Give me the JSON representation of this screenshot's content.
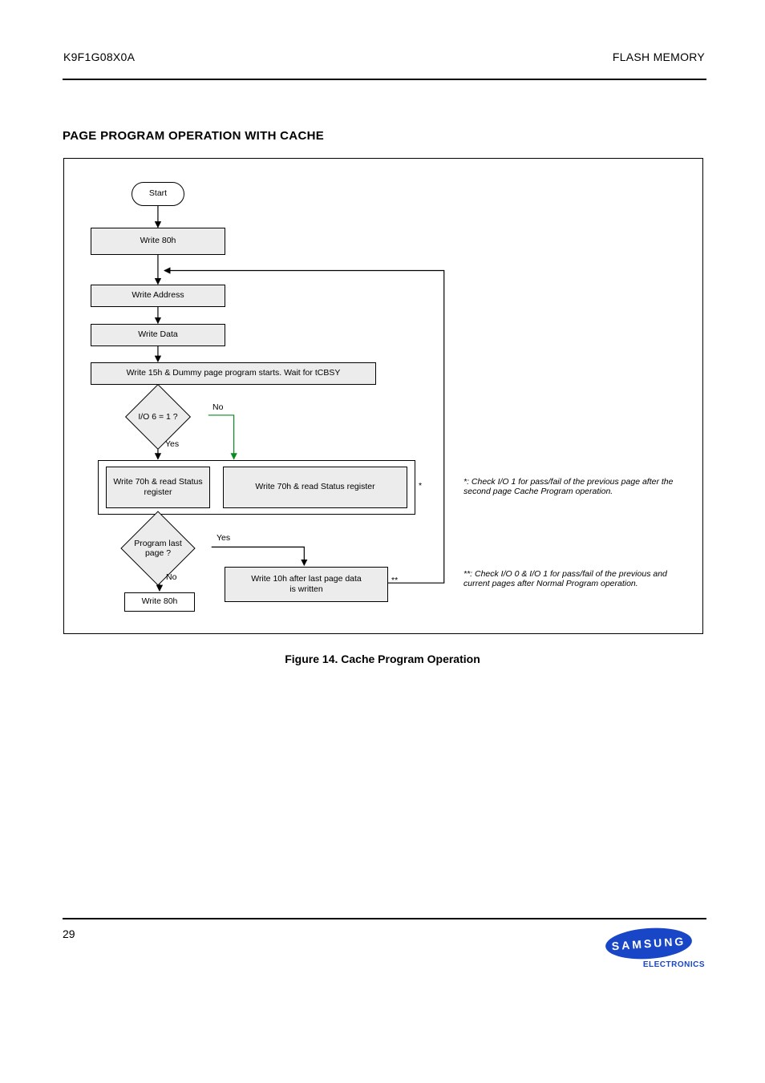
{
  "header": {
    "left": "K9F1G08X0A",
    "right": "FLASH MEMORY"
  },
  "section_title": "PAGE PROGRAM OPERATION WITH CACHE",
  "caption": "Figure 14. Cache Program Operation",
  "footer": {
    "page": "29",
    "logo_text": "SAMSUNG",
    "logo_sub": "ELECTRONICS"
  },
  "diagram": {
    "start": "Start",
    "write_80h": "Write 80h",
    "write_addr": "Write Address",
    "write_data": "Write Data",
    "write_15h_wait": "Write 15h & Dummy page program starts. Wait for tCBSY",
    "write_70h_read": "Write 70h & read Status register",
    "decision_io6": "I/O 6 = 1 ?",
    "decision_last": "Program last\npage ?",
    "write_80h_end": "Write 80h",
    "write_10h_end": "Write 10h after last page data\nis written",
    "labels": {
      "no": "No",
      "yes": "Yes"
    },
    "footnotes": {
      "first": "*: Check I/O 1 for pass/fail of the previous page after the second page Cache Program operation.",
      "second": "**: Check I/O 0 & I/O 1 for pass/fail of the previous and current pages after Normal Program operation."
    }
  }
}
